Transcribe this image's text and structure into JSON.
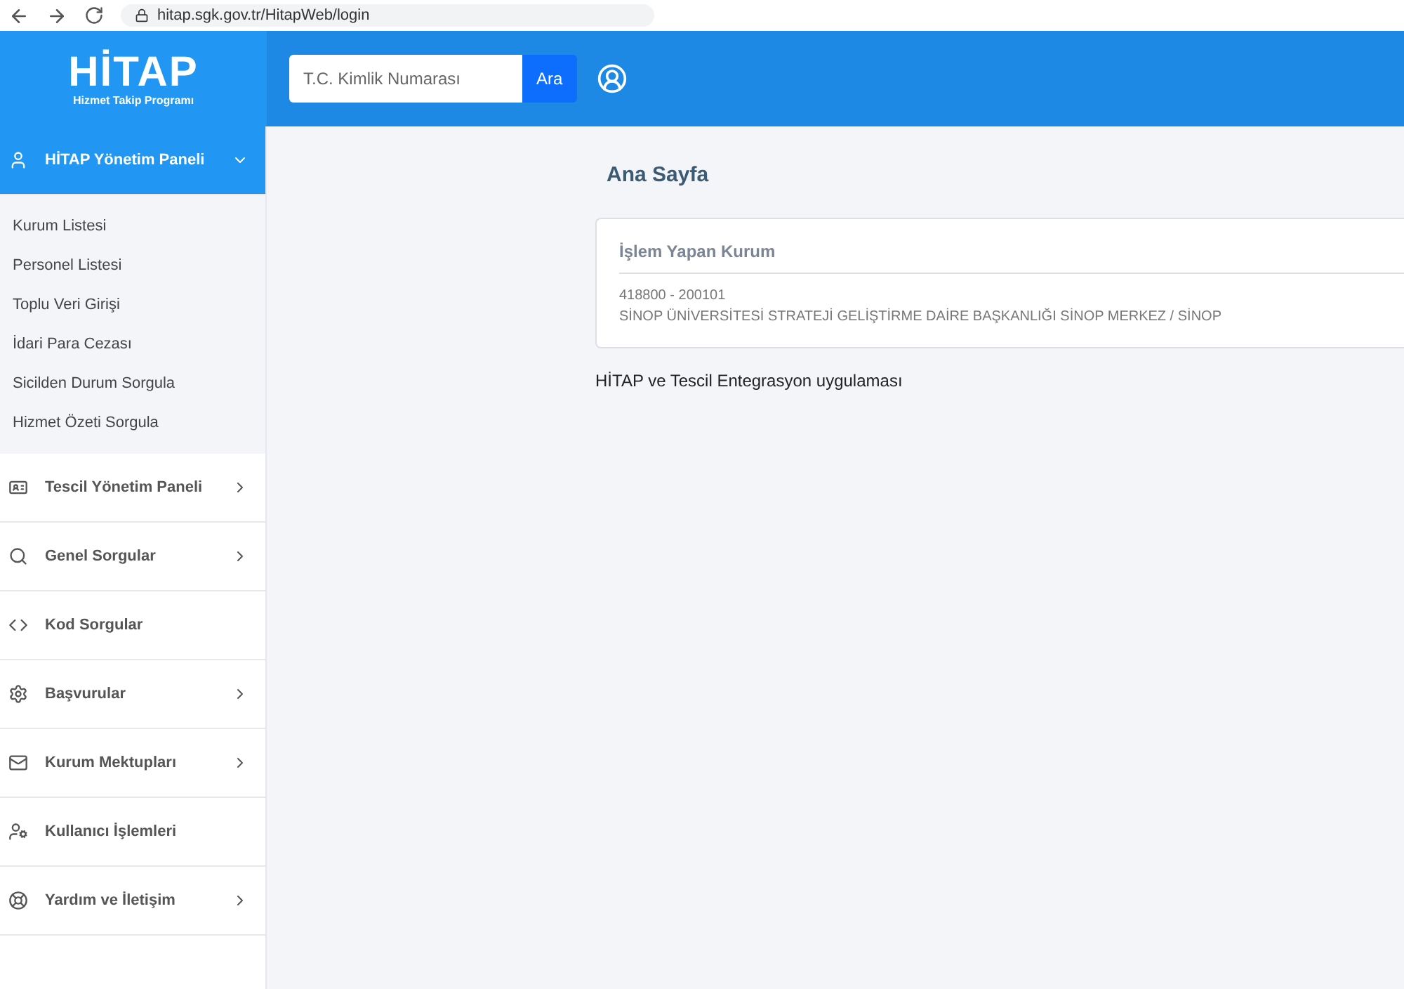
{
  "browser": {
    "url": "hitap.sgk.gov.tr/HitapWeb/login"
  },
  "logo": {
    "title": "HİTAP",
    "subtitle": "Hizmet Takip Programı"
  },
  "search": {
    "placeholder": "T.C. Kimlik Numarası",
    "button": "Ara"
  },
  "sidebar": {
    "sections": [
      {
        "kind": "user",
        "label": "HİTAP Yönetim Paneli",
        "submenu": true,
        "expanded": true,
        "children": [
          "Kurum Listesi",
          "Personel Listesi",
          "Toplu Veri Girişi",
          "İdari Para Cezası",
          "Sicilden Durum Sorgula",
          "Hizmet Özeti Sorgula"
        ]
      },
      {
        "kind": "idcard",
        "label": "Tescil Yönetim Paneli",
        "submenu": true,
        "expanded": false
      },
      {
        "kind": "search",
        "label": "Genel Sorgular",
        "submenu": true,
        "expanded": false
      },
      {
        "kind": "code",
        "label": "Kod Sorgular",
        "submenu": false,
        "expanded": false
      },
      {
        "kind": "gear",
        "label": "Başvurular",
        "submenu": true,
        "expanded": false
      },
      {
        "kind": "mail",
        "label": "Kurum Mektupları",
        "submenu": true,
        "expanded": false
      },
      {
        "kind": "usergear",
        "label": "Kullanıcı İşlemleri",
        "submenu": false,
        "expanded": false
      },
      {
        "kind": "help",
        "label": "Yardım ve İletişim",
        "submenu": true,
        "expanded": false
      }
    ]
  },
  "page": {
    "title": "Ana Sayfa",
    "card": {
      "title": "İşlem Yapan Kurum",
      "lines": [
        "418800 - 200101",
        "SİNOP ÜNİVERSİTESİ STRATEJİ GELİŞTİRME DAİRE BAŞKANLIĞI SİNOP MERKEZ / SİNOP"
      ]
    },
    "note": "HİTAP ve Tescil Entegrasyon uygulaması"
  }
}
